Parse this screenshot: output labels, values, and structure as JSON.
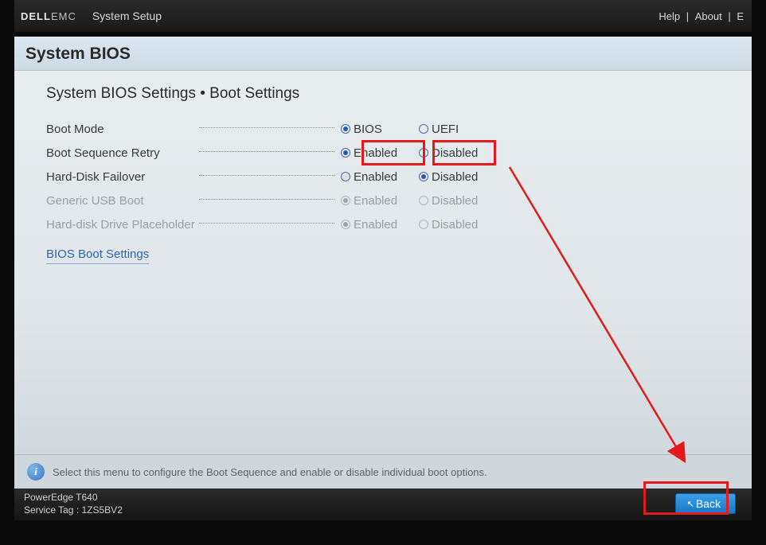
{
  "header": {
    "brand_main": "DELL",
    "brand_suffix": "EMC",
    "app_title": "System Setup",
    "help": "Help",
    "about": "About",
    "exit_partial": "E"
  },
  "panel": {
    "title": "System BIOS",
    "breadcrumb": "System BIOS Settings • Boot Settings"
  },
  "settings": [
    {
      "label": "Boot Mode",
      "opt1": "BIOS",
      "opt2": "UEFI",
      "selected": 1,
      "disabled": false
    },
    {
      "label": "Boot Sequence Retry",
      "opt1": "Enabled",
      "opt2": "Disabled",
      "selected": 1,
      "disabled": false
    },
    {
      "label": "Hard-Disk Failover",
      "opt1": "Enabled",
      "opt2": "Disabled",
      "selected": 2,
      "disabled": false
    },
    {
      "label": "Generic USB Boot",
      "opt1": "Enabled",
      "opt2": "Disabled",
      "selected": 1,
      "disabled": true
    },
    {
      "label": "Hard-disk Drive Placeholder",
      "opt1": "Enabled",
      "opt2": "Disabled",
      "selected": 1,
      "disabled": true
    }
  ],
  "link": {
    "bios_boot_settings": "BIOS Boot Settings"
  },
  "help_text": "Select this menu to configure the Boot Sequence and enable or disable individual boot options.",
  "footer": {
    "model": "PowerEdge T640",
    "service_tag_label": "Service Tag :",
    "service_tag": "1ZS5BV2",
    "back_label": "Back"
  }
}
